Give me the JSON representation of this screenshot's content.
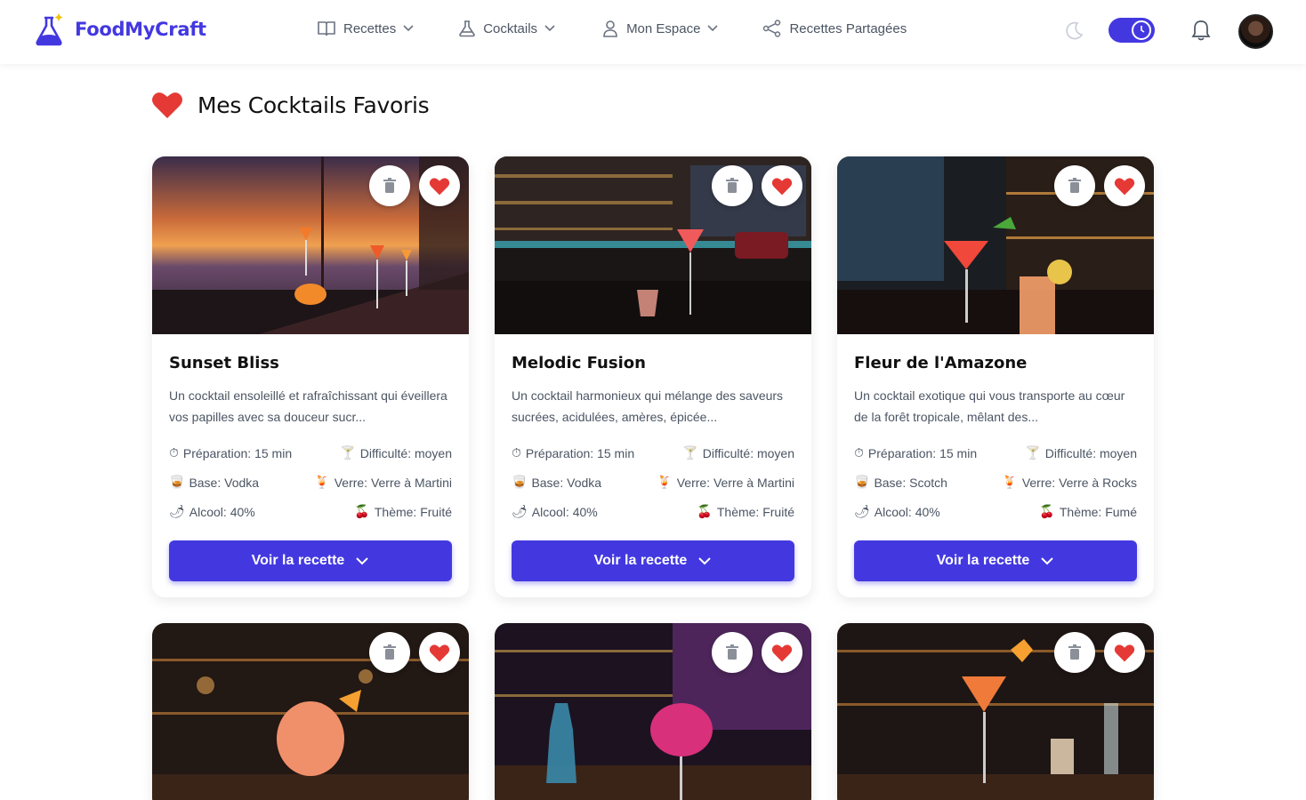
{
  "app": {
    "name": "FoodMyCraft"
  },
  "nav": [
    {
      "label": "Recettes",
      "icon": "book-icon",
      "dropdown": true
    },
    {
      "label": "Cocktails",
      "icon": "flask-icon",
      "dropdown": true
    },
    {
      "label": "Mon Espace",
      "icon": "user-icon",
      "dropdown": true
    },
    {
      "label": "Recettes Partagées",
      "icon": "share-icon",
      "dropdown": false
    }
  ],
  "header": {
    "theme_icon": "moon-icon",
    "toggle_icon": "clock-icon",
    "notifications_icon": "bell-icon"
  },
  "page": {
    "title": "Mes Cocktails Favoris",
    "title_icon": "heart-icon"
  },
  "colors": {
    "accent": "#4338e0",
    "heart": "#e53935"
  },
  "cards": [
    {
      "title": "Sunset Bliss",
      "description": "Un cocktail ensoleillé et rafraîchissant qui éveillera vos papilles avec sa douceur sucr...",
      "prep": "Préparation: 15 min",
      "difficulty": "Difficulté: moyen",
      "base": "Base: Vodka",
      "glass": "Verre: Verre à Martini",
      "alcohol": "Alcool: 40%",
      "theme": "Thème: Fruité",
      "cta": "Voir la recette"
    },
    {
      "title": "Melodic Fusion",
      "description": "Un cocktail harmonieux qui mélange des saveurs sucrées, acidulées, amères, épicée...",
      "prep": "Préparation: 15 min",
      "difficulty": "Difficulté: moyen",
      "base": "Base: Vodka",
      "glass": "Verre: Verre à Martini",
      "alcohol": "Alcool: 40%",
      "theme": "Thème: Fruité",
      "cta": "Voir la recette"
    },
    {
      "title": "Fleur de l'Amazone",
      "description": "Un cocktail exotique qui vous transporte au cœur de la forêt tropicale, mêlant des...",
      "prep": "Préparation: 15 min",
      "difficulty": "Difficulté: moyen",
      "base": "Base: Scotch",
      "glass": "Verre: Verre à Rocks",
      "alcohol": "Alcool: 40%",
      "theme": "Thème: Fumé",
      "cta": "Voir la recette"
    }
  ],
  "icons": {
    "prep": "⏱",
    "difficulty": "🍸",
    "base": "🥃",
    "glass": "🍹",
    "alcohol": "🌶",
    "theme": "🍒"
  }
}
